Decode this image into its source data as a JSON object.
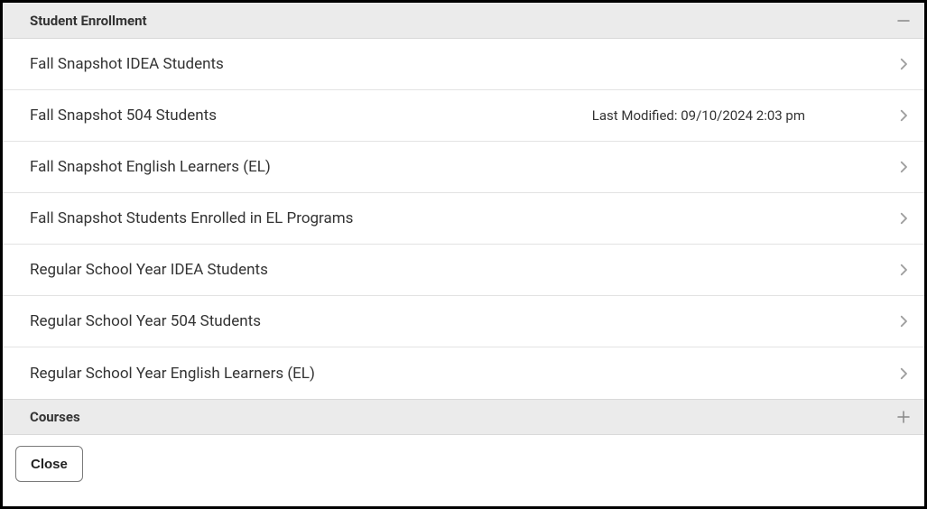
{
  "sections": [
    {
      "key": "studentEnrollment",
      "title": "Student Enrollment",
      "expanded": true,
      "items": [
        {
          "label": "Fall Snapshot IDEA Students",
          "meta": ""
        },
        {
          "label": "Fall Snapshot 504 Students",
          "meta": "Last Modified: 09/10/2024 2:03 pm"
        },
        {
          "label": "Fall Snapshot English Learners (EL)",
          "meta": ""
        },
        {
          "label": "Fall Snapshot Students Enrolled in EL Programs",
          "meta": ""
        },
        {
          "label": "Regular School Year IDEA Students",
          "meta": ""
        },
        {
          "label": "Regular School Year 504 Students",
          "meta": ""
        },
        {
          "label": "Regular School Year English Learners (EL)",
          "meta": ""
        }
      ]
    },
    {
      "key": "courses",
      "title": "Courses",
      "expanded": false,
      "items": []
    }
  ],
  "footer": {
    "closeLabel": "Close"
  }
}
